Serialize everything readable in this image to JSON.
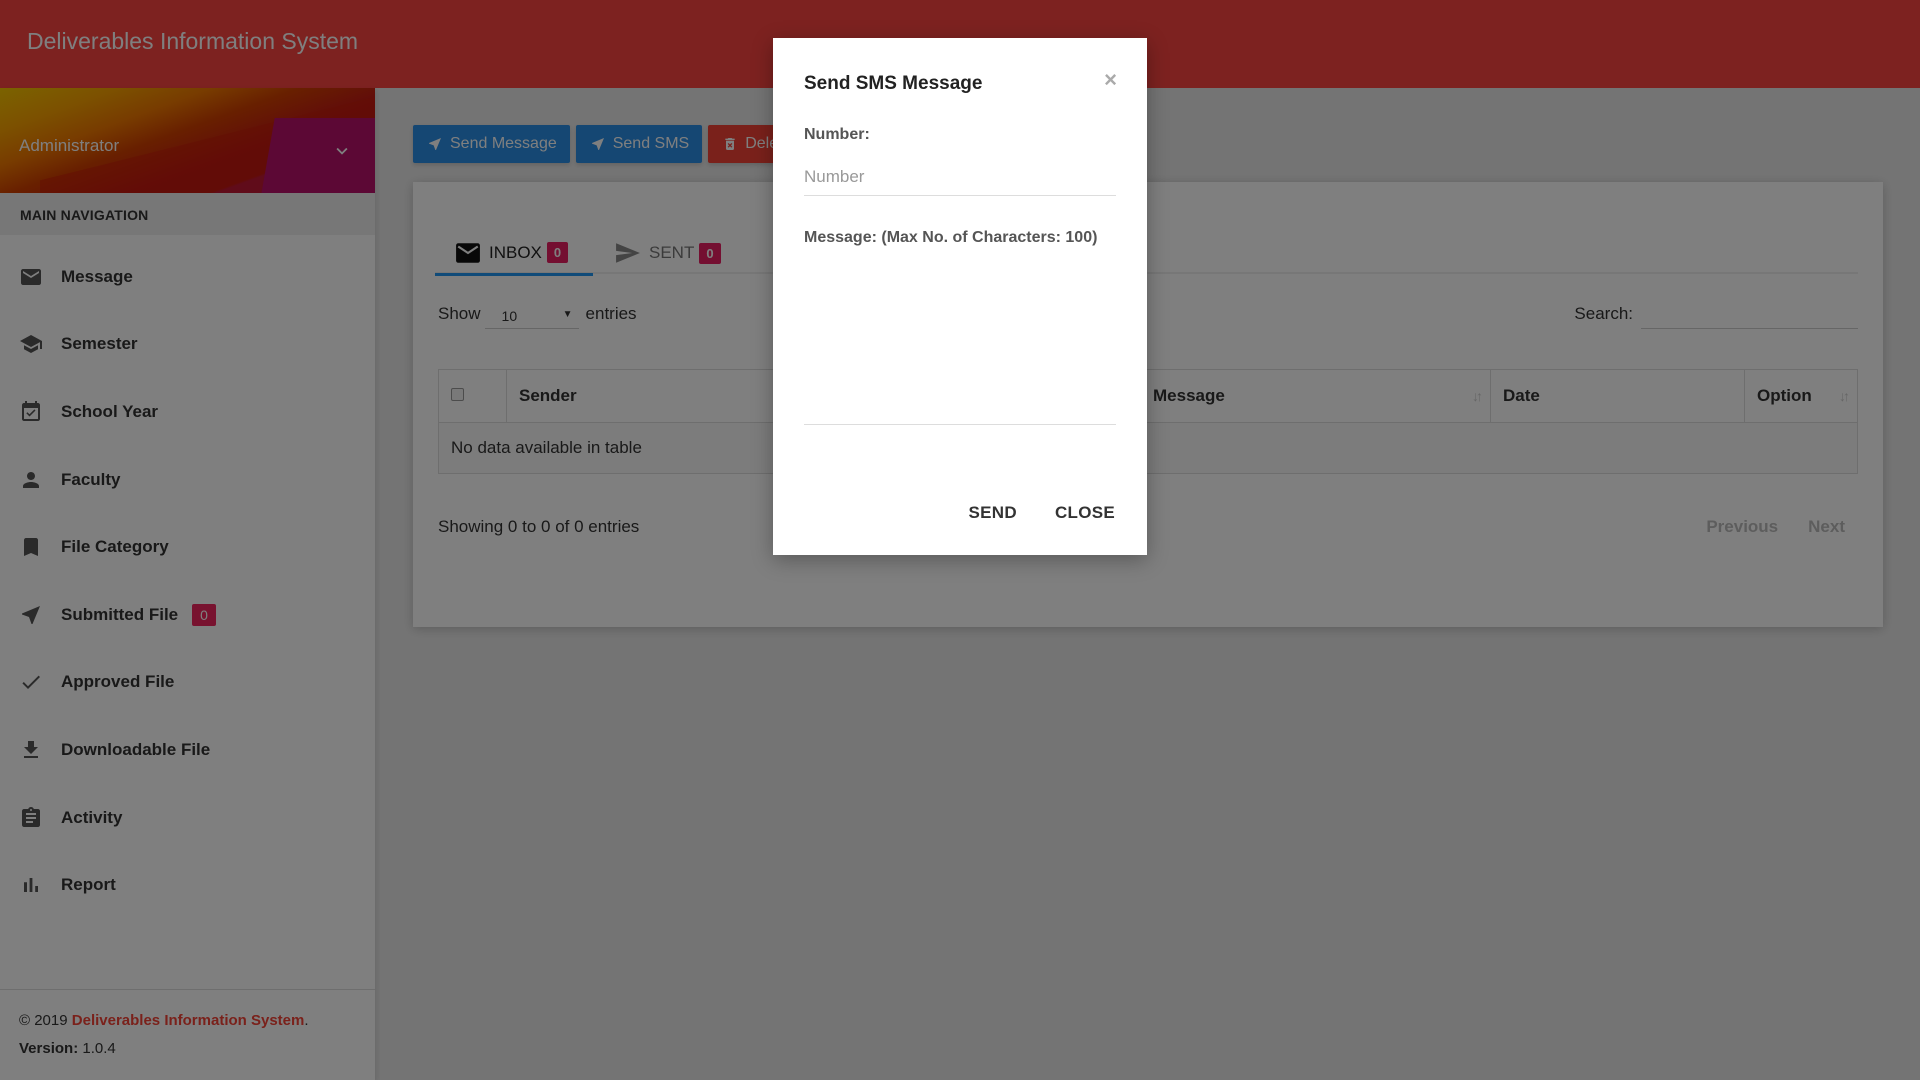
{
  "header": {
    "title": "Deliverables Information System"
  },
  "user": {
    "name": "Administrator"
  },
  "sidebar": {
    "section_label": "MAIN NAVIGATION",
    "items": [
      {
        "label": "Message",
        "icon": "mail-icon"
      },
      {
        "label": "Semester",
        "icon": "graduation-cap-icon"
      },
      {
        "label": "School Year",
        "icon": "calendar-check-icon"
      },
      {
        "label": "Faculty",
        "icon": "person-icon"
      },
      {
        "label": "File Category",
        "icon": "bookmark-icon"
      },
      {
        "label": "Submitted File",
        "icon": "send-icon",
        "badge": "0"
      },
      {
        "label": "Approved File",
        "icon": "check-icon"
      },
      {
        "label": "Downloadable File",
        "icon": "download-icon"
      },
      {
        "label": "Activity",
        "icon": "clipboard-icon"
      },
      {
        "label": "Report",
        "icon": "bar-chart-icon"
      }
    ],
    "footer": {
      "copyright_prefix": "© 2019 ",
      "copyright_link": "Deliverables Information System",
      "copyright_suffix": ".",
      "version_label": "Version:",
      "version_value": " 1.0.4"
    }
  },
  "toolbar": {
    "send_message_label": "Send Message",
    "send_sms_label": "Send SMS",
    "delete_label": "Delete"
  },
  "tabs": [
    {
      "label": "INBOX",
      "badge": "0",
      "active": true
    },
    {
      "label": "SENT",
      "badge": "0",
      "active": false
    }
  ],
  "table_controls": {
    "show_label": "Show",
    "page_length": "10",
    "entries_label": "entries",
    "search_label": "Search:",
    "search_value": ""
  },
  "table": {
    "columns": [
      "",
      "Sender",
      "Message",
      "Date",
      "Option"
    ],
    "empty_message": "No data available in table",
    "info": "Showing 0 to 0 of 0 entries",
    "previous_label": "Previous",
    "next_label": "Next"
  },
  "modal": {
    "title": "Send SMS Message",
    "close_symbol": "×",
    "number_label": "Number:",
    "number_placeholder": "Number",
    "number_value": "",
    "message_label": "Message: (Max No. of Characters: 100)",
    "message_value": "",
    "send_label": "SEND",
    "close_label": "CLOSE"
  },
  "colors": {
    "header": "#fa4441",
    "primary": "#2196f3",
    "danger": "#f44336",
    "badge": "#e91e63"
  }
}
